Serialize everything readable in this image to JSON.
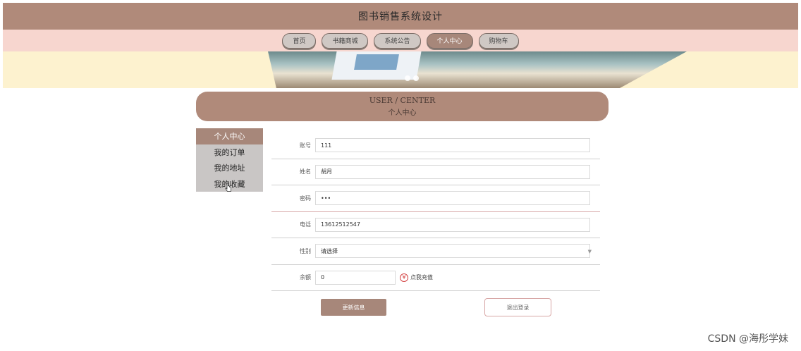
{
  "header": {
    "title": "图书销售系统设计"
  },
  "nav": {
    "items": [
      {
        "label": "首页"
      },
      {
        "label": "书籍商城"
      },
      {
        "label": "系统公告"
      },
      {
        "label": "个人中心",
        "active": true
      },
      {
        "label": "购物车"
      }
    ]
  },
  "center": {
    "title_en": "USER / CENTER",
    "title_cn": "个人中心"
  },
  "sidebar": {
    "items": [
      {
        "label": "个人中心",
        "active": true
      },
      {
        "label": "我的订单"
      },
      {
        "label": "我的地址"
      },
      {
        "label": "我的收藏"
      }
    ]
  },
  "form": {
    "account": {
      "label": "账号",
      "value": "111"
    },
    "name": {
      "label": "姓名",
      "value": "胡月"
    },
    "password": {
      "label": "密码",
      "value": "•••"
    },
    "phone": {
      "label": "电话",
      "value": "13612512547"
    },
    "gender": {
      "label": "性别",
      "value": "请选择"
    },
    "balance": {
      "label": "余额",
      "value": "0",
      "recharge": "点我充值"
    }
  },
  "buttons": {
    "update": "更新信息",
    "logout": "退出登录"
  },
  "watermark": "CSDN @海彤学妹",
  "colors": {
    "header": "#b08a7a",
    "nav": "#f7d6cf",
    "banner": "#fdf2cf",
    "accent": "#a7877a"
  }
}
